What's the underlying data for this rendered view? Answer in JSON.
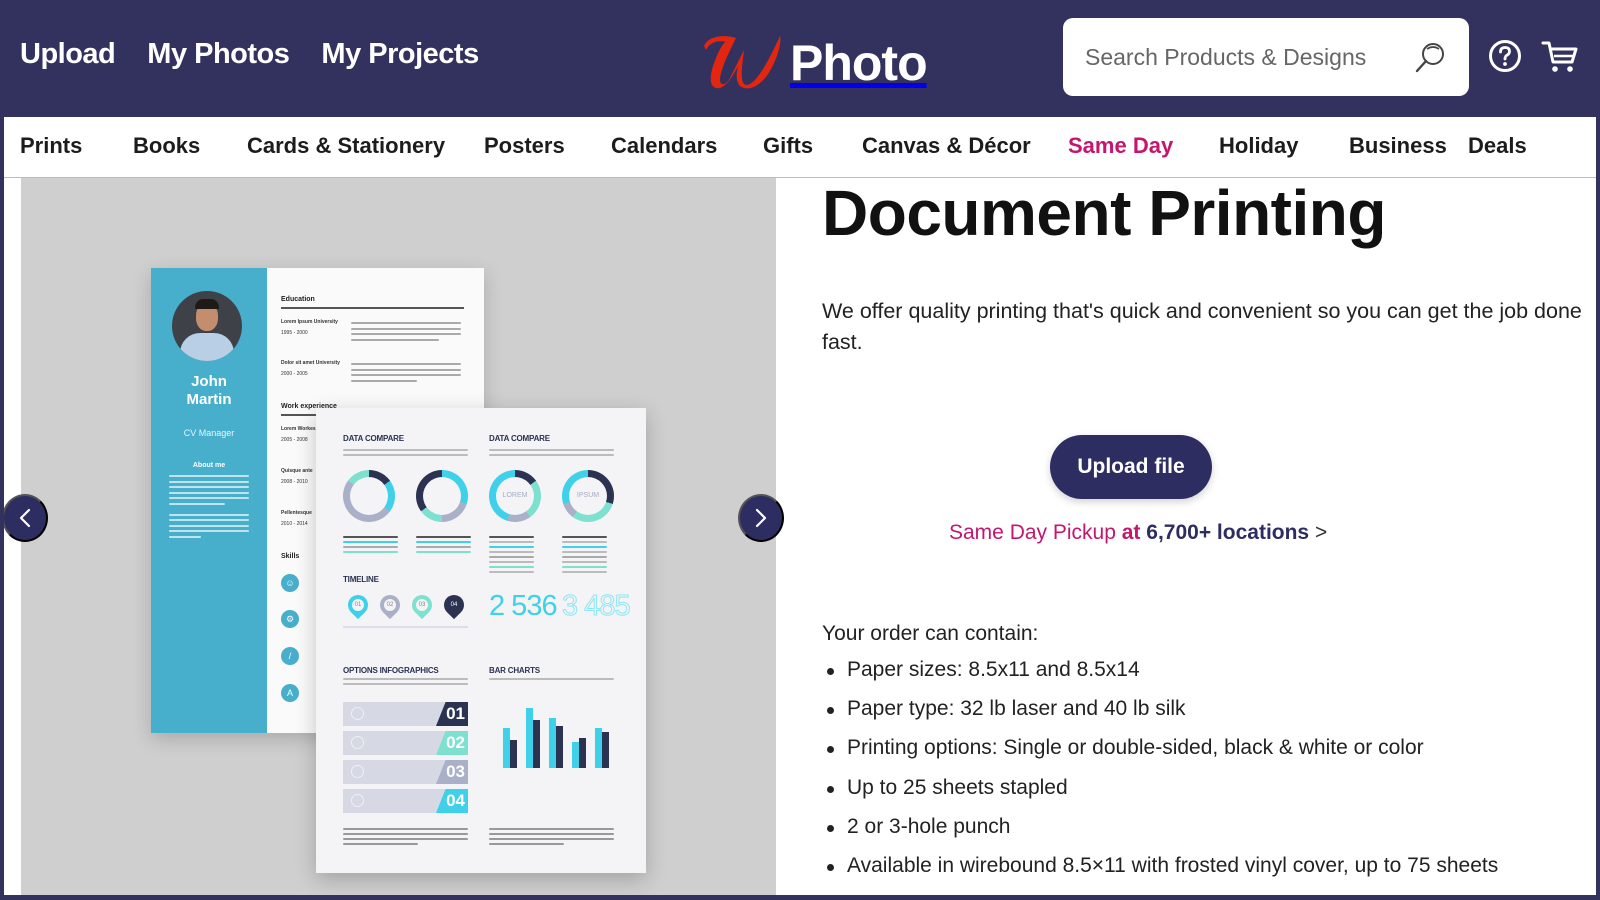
{
  "header": {
    "nav_links": [
      "Upload",
      "My Photos",
      "My Projects"
    ],
    "logo_mark": "W",
    "logo_text": "Photo",
    "search_placeholder": "Search Products & Designs",
    "icons": [
      "search-icon",
      "help-icon",
      "cart-icon"
    ],
    "brand_color": "#33325f",
    "logo_color": "#e3260f"
  },
  "categories": [
    {
      "label": "Prints",
      "active": false
    },
    {
      "label": "Books",
      "active": false
    },
    {
      "label": "Cards & Stationery",
      "active": false
    },
    {
      "label": "Posters",
      "active": false
    },
    {
      "label": "Calendars",
      "active": false
    },
    {
      "label": "Gifts",
      "active": false
    },
    {
      "label": "Canvas & Décor",
      "active": false
    },
    {
      "label": "Same Day",
      "active": true
    },
    {
      "label": "Holiday",
      "active": false
    },
    {
      "label": "Business",
      "active": false
    },
    {
      "label": "Deals",
      "active": false
    }
  ],
  "accent_color": "#c4166e",
  "carousel": {
    "prev_icon": "chevron-left-icon",
    "next_icon": "chevron-right-icon",
    "resume": {
      "name_line1": "John",
      "name_line2": "Martin",
      "role": "CV Manager",
      "about_heading": "About me",
      "education_heading": "Education",
      "education_entries": [
        {
          "school": "Lorem Ipsum University",
          "years": "1995 - 2000"
        },
        {
          "school": "Dolor sit amet University",
          "years": "2000 - 2005"
        }
      ],
      "work_heading": "Work experience",
      "work_entries": [
        {
          "title": "Lorem Workes",
          "years": "2005 - 2008"
        },
        {
          "title": "Quisque ante",
          "years": "2008 - 2010"
        },
        {
          "title": "Pellentesque",
          "years": "2010 - 2014"
        }
      ],
      "skills_heading": "Skills"
    },
    "infographic": {
      "data_compare_1": "DATA COMPARE",
      "data_compare_2": "DATA COMPARE",
      "ring_labels": [
        "",
        "",
        "LOREM",
        "IPSUM"
      ],
      "timeline_heading": "TIMELINE",
      "timeline_pins": [
        "01",
        "02",
        "03",
        "04"
      ],
      "stat_1": "2 536",
      "stat_2": "3 485",
      "options_heading": "OPTIONS INFOGRAPHICS",
      "options": [
        "01",
        "02",
        "03",
        "04"
      ],
      "bar_charts_heading": "BAR CHARTS"
    }
  },
  "content": {
    "title": "Document Printing",
    "lead": "We offer quality printing that's quick and convenient so you can get the job done fast.",
    "upload_button": "Upload file",
    "pickup": {
      "text": "Same Day Pickup",
      "at": "at",
      "locations": "6,700+ locations",
      "arrow": ">"
    },
    "order_label": "Your order can contain:",
    "features": [
      "Paper sizes: 8.5x11 and 8.5x14",
      "Paper type: 32 lb laser and 40 lb silk",
      "Printing options: Single or double-sided, black & white or color",
      "Up to 25 sheets stapled",
      "2 or 3-hole punch",
      "Available in wirebound 8.5×11 with frosted vinyl cover, up to 75 sheets"
    ]
  }
}
